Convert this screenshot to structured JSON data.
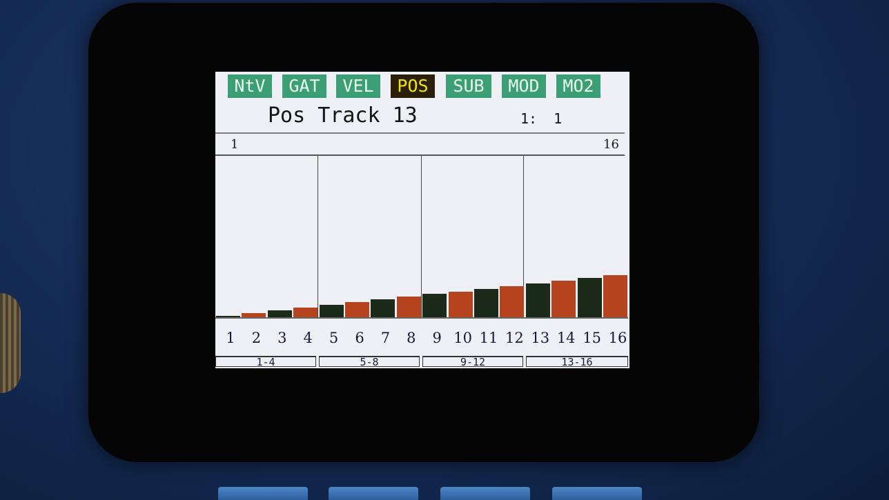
{
  "tabs": [
    {
      "label": "NtV",
      "active": false
    },
    {
      "label": "GAT",
      "active": false
    },
    {
      "label": "VEL",
      "active": false
    },
    {
      "label": "POS",
      "active": true
    },
    {
      "label": "SUB",
      "active": false
    },
    {
      "label": "MOD",
      "active": false
    },
    {
      "label": "MO2",
      "active": false
    }
  ],
  "header": {
    "title": "Pos Track 13",
    "position": "1:  1"
  },
  "range": {
    "start": "1",
    "end": "16"
  },
  "steps": [
    "1",
    "2",
    "3",
    "4",
    "5",
    "6",
    "7",
    "8",
    "9",
    "10",
    "11",
    "12",
    "13",
    "14",
    "15",
    "16"
  ],
  "step_values": [
    0.01,
    0.027,
    0.044,
    0.06,
    0.077,
    0.094,
    0.11,
    0.127,
    0.144,
    0.16,
    0.177,
    0.194,
    0.21,
    0.227,
    0.244,
    0.26
  ],
  "groups": [
    "1-4",
    "5-8",
    "9-12",
    "13-16"
  ],
  "colors": {
    "bar_dark": "#1c2b19",
    "bar_orange": "#b5431d",
    "tab_bg": "#3b9e75",
    "tab_active_bg": "#2c1e08",
    "tab_active_fg": "#f0e800"
  }
}
